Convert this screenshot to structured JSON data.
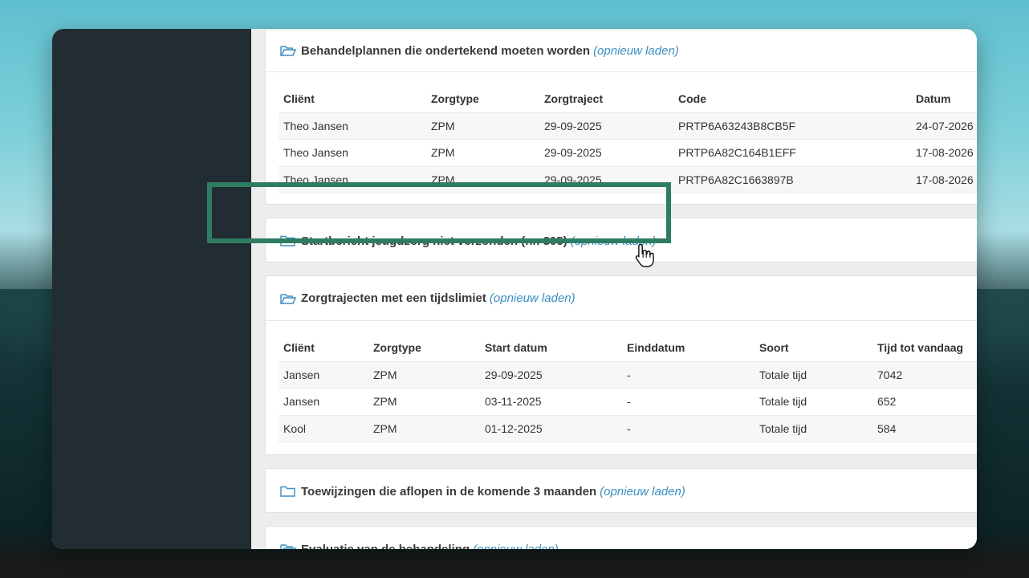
{
  "panels": [
    {
      "title": "Behandelplannen die ondertekend moeten worden",
      "reload": "(opnieuw laden)",
      "open": true,
      "headers": [
        "Cliënt",
        "Zorgtype",
        "Zorgtraject",
        "Code",
        "Datum"
      ],
      "rows": [
        [
          "Theo Jansen",
          "ZPM",
          "29-09-2025",
          "PRTP6A63243B8CB5F",
          "24-07-2026"
        ],
        [
          "Theo Jansen",
          "ZPM",
          "29-09-2025",
          "PRTP6A82C164B1EFF",
          "17-08-2026"
        ],
        [
          "Theo Jansen",
          "ZPM",
          "29-09-2025",
          "PRTP6A82C1663897B",
          "17-08-2026"
        ]
      ]
    },
    {
      "title": "Startbericht jeugdzorg niet verzonden (nr. 305)",
      "reload": "(opnieuw laden)",
      "open": false
    },
    {
      "title": "Zorgtrajecten met een tijdslimiet",
      "reload": "(opnieuw laden)",
      "open": true,
      "headers": [
        "Cliënt",
        "Zorgtype",
        "Start datum",
        "Einddatum",
        "Soort",
        "Tijd tot vandaag"
      ],
      "rows": [
        [
          "Jansen",
          "ZPM",
          "29-09-2025",
          "-",
          "Totale tijd",
          "7042"
        ],
        [
          "Jansen",
          "ZPM",
          "03-11-2025",
          "-",
          "Totale tijd",
          "652"
        ],
        [
          "Kool",
          "ZPM",
          "01-12-2025",
          "-",
          "Totale tijd",
          "584"
        ]
      ]
    },
    {
      "title": "Toewijzingen die aflopen in de komende 3 maanden",
      "reload": "(opnieuw laden)",
      "open": false
    },
    {
      "title": "Evaluatie van de behandeling",
      "reload": "(opnieuw laden)",
      "open": false
    }
  ],
  "colors": {
    "highlight": "#2e7d63",
    "link": "#3a8fc0",
    "sidebar": "#222c33"
  },
  "icons": {
    "open_folder": "folder-open-icon",
    "closed_folder": "folder-icon",
    "cursor": "hand-pointer-icon"
  }
}
